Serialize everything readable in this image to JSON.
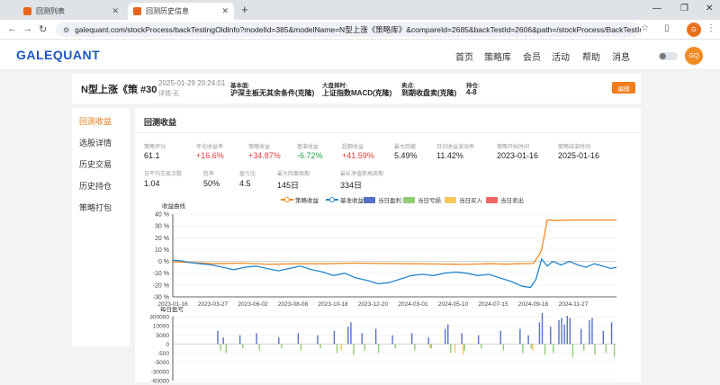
{
  "browser": {
    "tabs": [
      {
        "label": "回测列表"
      },
      {
        "label": "回测历史信息"
      }
    ],
    "new_tab": "+",
    "url": "galequant.com/stockProcess/backTestingOldInfo?modelId=385&modelName=N型上涨《策略库》&compareId=2685&backTestId=2606&path=/stockProcess/BackTestInfo",
    "profile_initials": "G"
  },
  "site": {
    "logo_main": "GALEQUANT",
    "nav": [
      "首页",
      "策略库",
      "会员",
      "活动",
      "帮助",
      "消息"
    ],
    "avatar": "GQ"
  },
  "strategy": {
    "name": "N型上涨《策 #30",
    "date": "2025-01-29 20:24:01",
    "remark": "详情:无",
    "meta": [
      {
        "label": "基本面:",
        "value": "沪深主板无其余条件(克隆)"
      },
      {
        "label": "大盘择时:",
        "value": "上证指数MACD(克隆)"
      },
      {
        "label": "卖点:",
        "value": "到期收盘卖(克隆)"
      },
      {
        "label": "持仓:",
        "value": "4-8"
      }
    ],
    "edit_label": "编辑"
  },
  "sidemenu": [
    "回测收益",
    "选股详情",
    "历史交易",
    "历史持仓",
    "策略打包"
  ],
  "panel": {
    "title": "回测收益",
    "metrics_row1": [
      {
        "label": "策略评分",
        "value": "61.1",
        "tone": ""
      },
      {
        "label": "年化收益率",
        "value": "+16.6%",
        "tone": "red"
      },
      {
        "label": "策略收益",
        "value": "+34.87%",
        "tone": "red"
      },
      {
        "label": "基准收益",
        "value": "-6.72%",
        "tone": "green"
      },
      {
        "label": "超额收益",
        "value": "+41.59%",
        "tone": "red"
      },
      {
        "label": "最大回撤",
        "value": "5.49%",
        "tone": ""
      },
      {
        "label": "日均收益波动率",
        "value": "11.42%",
        "tone": ""
      },
      {
        "label": "策略开始时间",
        "value": "2023-01-16",
        "tone": ""
      },
      {
        "label": "策略结束时间",
        "value": "2025-01-16",
        "tone": ""
      }
    ],
    "metrics_row2": [
      {
        "label": "日平均交易次数",
        "value": "1.04"
      },
      {
        "label": "胜率",
        "value": "50%"
      },
      {
        "label": "盈亏比",
        "value": "4.5"
      },
      {
        "label": "最大回撤周期",
        "value": "145日"
      },
      {
        "label": "最长净值新高周期",
        "value": "334日"
      }
    ]
  },
  "colors": {
    "strategy": "#f08a24",
    "benchmark": "#2587c9",
    "profit": "#5470c6",
    "loss": "#91cc75",
    "buy": "#fac858",
    "sell": "#ee6666",
    "accent": "#e67a17"
  },
  "chart_data": [
    {
      "type": "line",
      "title": "收益曲线",
      "legend": [
        "策略收益",
        "基准收益",
        "当日盈利",
        "当日亏损",
        "当日买入",
        "当日卖出"
      ],
      "x_ticks": [
        "2023-01-16",
        "2023-03-27",
        "2023-06-02",
        "2023-08-08",
        "2023-10-18",
        "2023-12-20",
        "2024-03-01",
        "2024-05-10",
        "2024-07-15",
        "2024-09-18",
        "2024-11-27"
      ],
      "y_ticks": [
        "40 %",
        "30 %",
        "20 %",
        "10 %",
        "0 %",
        "-10 %",
        "-20 %",
        "-30 %"
      ],
      "ylim": [
        -30,
        40
      ],
      "series": [
        {
          "name": "策略收益",
          "points": [
            [
              0,
              -0.5
            ],
            [
              8,
              -1
            ],
            [
              15,
              -2
            ],
            [
              25,
              -1.5
            ],
            [
              35,
              -2.5
            ],
            [
              45,
              -2
            ],
            [
              55,
              -2
            ],
            [
              65,
              -1.5
            ],
            [
              75,
              -1.8
            ],
            [
              85,
              -2
            ],
            [
              95,
              -2.2
            ],
            [
              105,
              -2.5
            ],
            [
              110,
              -2.2
            ],
            [
              115,
              -2
            ],
            [
              120,
              -2.4
            ],
            [
              125,
              -2
            ],
            [
              130,
              -1.8
            ],
            [
              132,
              5
            ],
            [
              133,
              10
            ],
            [
              134,
              22
            ],
            [
              135,
              35
            ],
            [
              138,
              34.5
            ],
            [
              145,
              35
            ],
            [
              155,
              35
            ],
            [
              160,
              35
            ]
          ]
        },
        {
          "name": "基准收益",
          "points": [
            [
              0,
              1
            ],
            [
              3,
              0.5
            ],
            [
              6,
              -1
            ],
            [
              10,
              -2
            ],
            [
              14,
              -3
            ],
            [
              18,
              -5
            ],
            [
              22,
              -7
            ],
            [
              26,
              -5
            ],
            [
              30,
              -4
            ],
            [
              34,
              -6
            ],
            [
              38,
              -8
            ],
            [
              42,
              -6
            ],
            [
              46,
              -4
            ],
            [
              50,
              -7
            ],
            [
              54,
              -9
            ],
            [
              58,
              -12
            ],
            [
              62,
              -10
            ],
            [
              66,
              -14
            ],
            [
              70,
              -16
            ],
            [
              74,
              -19
            ],
            [
              78,
              -18
            ],
            [
              82,
              -15
            ],
            [
              86,
              -12
            ],
            [
              90,
              -11
            ],
            [
              94,
              -12
            ],
            [
              98,
              -10
            ],
            [
              102,
              -9
            ],
            [
              106,
              -10
            ],
            [
              110,
              -12
            ],
            [
              114,
              -11
            ],
            [
              118,
              -14
            ],
            [
              122,
              -17
            ],
            [
              126,
              -21
            ],
            [
              129,
              -22
            ],
            [
              131,
              -15
            ],
            [
              133,
              2
            ],
            [
              135,
              -4
            ],
            [
              137,
              0
            ],
            [
              140,
              -3
            ],
            [
              143,
              0
            ],
            [
              146,
              -3
            ],
            [
              149,
              -5
            ],
            [
              152,
              -2
            ],
            [
              155,
              -4
            ],
            [
              158,
              -6
            ],
            [
              160,
              -5
            ]
          ]
        }
      ]
    },
    {
      "type": "bar",
      "title": "每日盈亏",
      "x_ticks": [
        "2023-01-16",
        "2023-03-27",
        "2023-06-02",
        "2023-08-08",
        "2023-10-18",
        "2023-12-20",
        "2024-03-01",
        "2024-05-10",
        "2024-07-15",
        "2024-09-18",
        "2024-11-27"
      ],
      "y_ticks": [
        "300000",
        "10000",
        "5000",
        "0",
        "-500",
        "-5000",
        "-30000",
        "-60000"
      ],
      "ylim": [
        -60000,
        300000
      ],
      "profit": [
        [
          16,
          6
        ],
        [
          18,
          3
        ],
        [
          24,
          4
        ],
        [
          30,
          5
        ],
        [
          38,
          3
        ],
        [
          45,
          5
        ],
        [
          52,
          4
        ],
        [
          58,
          6
        ],
        [
          63,
          8
        ],
        [
          64,
          10
        ],
        [
          68,
          5
        ],
        [
          73,
          7
        ],
        [
          79,
          4
        ],
        [
          86,
          5
        ],
        [
          92,
          3
        ],
        [
          98,
          7
        ],
        [
          99,
          9
        ],
        [
          104,
          5
        ],
        [
          110,
          4
        ],
        [
          118,
          6
        ],
        [
          125,
          7
        ],
        [
          128,
          4
        ],
        [
          132,
          10
        ],
        [
          133,
          15
        ],
        [
          136,
          8
        ],
        [
          139,
          11
        ],
        [
          140,
          12
        ],
        [
          141,
          9
        ],
        [
          142,
          13
        ],
        [
          143,
          12
        ],
        [
          147,
          7
        ],
        [
          150,
          11
        ],
        [
          151,
          12
        ],
        [
          155,
          6
        ],
        [
          158,
          10
        ]
      ],
      "loss": [
        [
          17,
          3
        ],
        [
          19,
          4
        ],
        [
          25,
          2
        ],
        [
          31,
          3
        ],
        [
          39,
          2
        ],
        [
          46,
          3
        ],
        [
          53,
          2
        ],
        [
          59,
          4
        ],
        [
          65,
          5
        ],
        [
          69,
          3
        ],
        [
          74,
          4
        ],
        [
          80,
          2
        ],
        [
          87,
          3
        ],
        [
          93,
          2
        ],
        [
          100,
          4
        ],
        [
          105,
          3
        ],
        [
          111,
          2
        ],
        [
          119,
          3
        ],
        [
          126,
          4
        ],
        [
          129,
          2
        ],
        [
          134,
          5
        ],
        [
          137,
          4
        ],
        [
          144,
          6
        ],
        [
          148,
          3
        ],
        [
          152,
          5
        ],
        [
          156,
          4
        ],
        [
          159,
          6
        ]
      ],
      "buy": [
        [
          60,
          3
        ],
        [
          92,
          2
        ],
        [
          101,
          4
        ],
        [
          104,
          5
        ],
        [
          129,
          3
        ]
      ],
      "sell": []
    }
  ]
}
